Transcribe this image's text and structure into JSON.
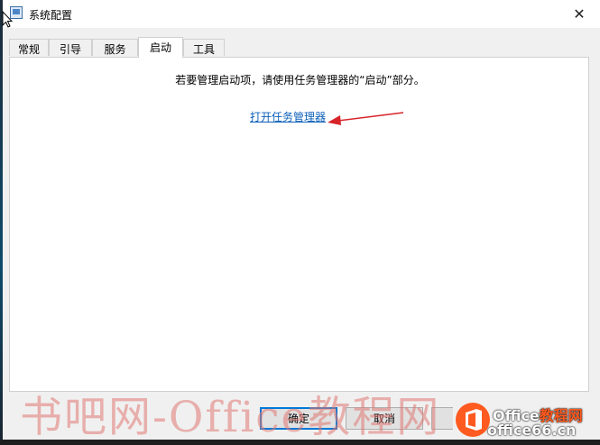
{
  "window": {
    "title": "系统配置",
    "close_glyph": "✕"
  },
  "tabs": [
    {
      "label": "常规",
      "active": false
    },
    {
      "label": "引导",
      "active": false
    },
    {
      "label": "服务",
      "active": false
    },
    {
      "label": "启动",
      "active": true
    },
    {
      "label": "工具",
      "active": false
    }
  ],
  "startup": {
    "info_text": "若要管理启动项，请使用任务管理器的“启动”部分。",
    "link_text": "打开任务管理器"
  },
  "buttons": {
    "ok": "确定",
    "cancel": "取消"
  },
  "watermark": {
    "text": "书吧网-Office教程网"
  },
  "logo": {
    "line1": "Office",
    "line1_cn": "教程网",
    "line2": "office66.cn"
  },
  "colors": {
    "link": "#0b5fb8",
    "arrow": "#d8232a",
    "default_button_border": "#0078d7"
  },
  "icons": [
    "app-icon",
    "close-icon",
    "red-arrow-annotation",
    "office-logo-icon",
    "mouse-cursor-icon"
  ]
}
